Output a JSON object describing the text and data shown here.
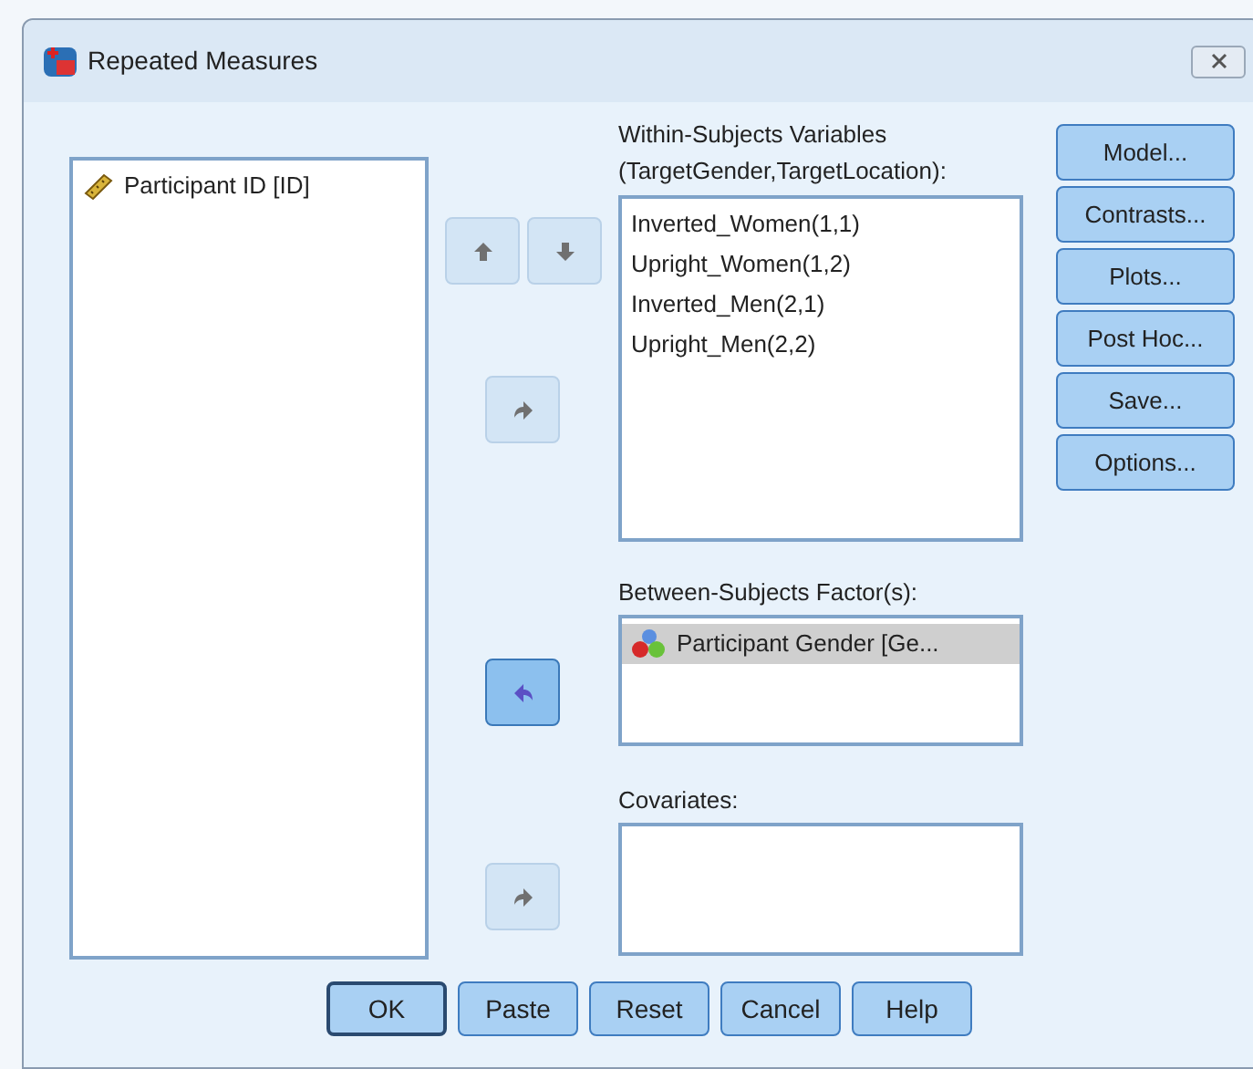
{
  "window": {
    "title": "Repeated Measures"
  },
  "source_list": {
    "items": [
      {
        "label": "Participant ID [ID]",
        "kind": "scale",
        "selected": false
      }
    ]
  },
  "arrow_buttons": [
    {
      "kind": "up",
      "disabled": true
    },
    {
      "kind": "down",
      "disabled": true
    },
    {
      "kind": "right",
      "disabled": true
    },
    {
      "kind": "left",
      "disabled": false
    },
    {
      "kind": "right",
      "disabled": true
    }
  ],
  "within_subjects": {
    "label": "Within-Subjects Variables",
    "sublabel": "(TargetGender,TargetLocation):",
    "items": [
      {
        "label": "Inverted_Women(1,1)",
        "selected": false
      },
      {
        "label": "Upright_Women(1,2)",
        "selected": false
      },
      {
        "label": "Inverted_Men(2,1)",
        "selected": false
      },
      {
        "label": "Upright_Men(2,2)",
        "selected": false
      }
    ]
  },
  "between_subjects": {
    "label": "Between-Subjects Factor(s):",
    "items": [
      {
        "label": "Participant Gender [Ge...",
        "kind": "nominal",
        "selected": true
      }
    ]
  },
  "covariates": {
    "label": "Covariates:"
  },
  "side_buttons": [
    {
      "label": "Model..."
    },
    {
      "label": "Contrasts..."
    },
    {
      "label": "Plots..."
    },
    {
      "label": "Post Hoc..."
    },
    {
      "label": "Save..."
    },
    {
      "label": "Options..."
    }
  ],
  "bottom_buttons": [
    {
      "label": "OK",
      "default": true
    },
    {
      "label": "Paste",
      "default": false
    },
    {
      "label": "Reset",
      "default": false
    },
    {
      "label": "Cancel",
      "default": false
    },
    {
      "label": "Help",
      "default": false
    }
  ]
}
